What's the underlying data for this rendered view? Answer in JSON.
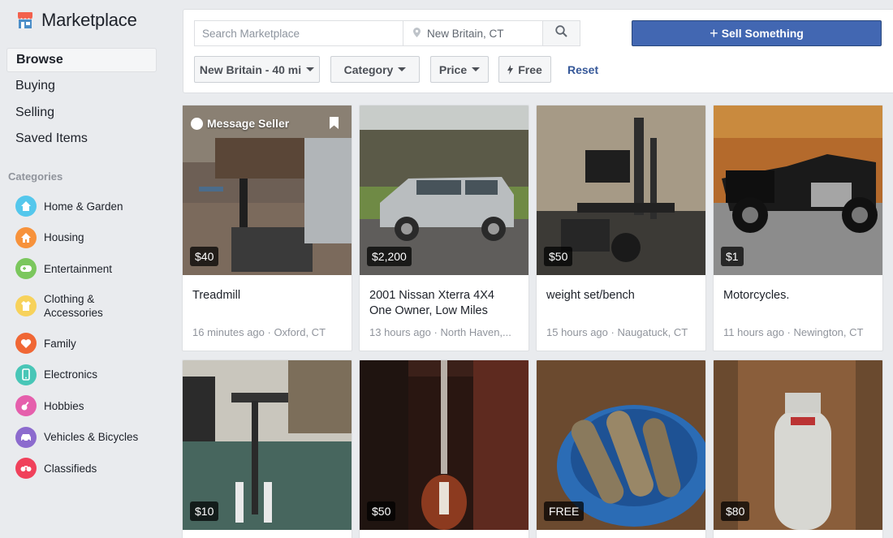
{
  "brand": {
    "title": "Marketplace",
    "icon": "shop-icon",
    "color": "#f3614d"
  },
  "nav": [
    "Browse",
    "Buying",
    "Selling",
    "Saved Items"
  ],
  "categories_heading": "Categories",
  "categories": [
    {
      "label": "Home & Garden",
      "icon": "home-icon",
      "color": "#54c7ec"
    },
    {
      "label": "Housing",
      "icon": "house-icon",
      "color": "#f7923b"
    },
    {
      "label": "Entertainment",
      "icon": "gamepad-icon",
      "color": "#7bc75d"
    },
    {
      "label": "Clothing & Accessories",
      "icon": "shirt-icon",
      "color": "#f7d25b"
    },
    {
      "label": "Family",
      "icon": "heart-icon",
      "color": "#f06735"
    },
    {
      "label": "Electronics",
      "icon": "phone-icon",
      "color": "#48c6b7"
    },
    {
      "label": "Hobbies",
      "icon": "guitar-icon",
      "color": "#e55fac"
    },
    {
      "label": "Vehicles & Bicycles",
      "icon": "car-icon",
      "color": "#8c6bce"
    },
    {
      "label": "Classifieds",
      "icon": "classifieds-icon",
      "color": "#f0415b"
    }
  ],
  "search": {
    "placeholder": "Search Marketplace",
    "location": "New Britain, CT"
  },
  "sell_button": "Sell Something",
  "filters": {
    "radius": "New Britain - 40 mi",
    "category": "Category",
    "price": "Price",
    "free": "Free",
    "reset": "Reset"
  },
  "listings": [
    {
      "price": "$40",
      "title": "Treadmill",
      "meta": "16 minutes ago · Oxford, CT",
      "hover": "Message Seller"
    },
    {
      "price": "$2,200",
      "title": "2001 Nissan Xterra 4X4 One Owner, Low Miles",
      "meta": "13 hours ago · North Haven,..."
    },
    {
      "price": "$50",
      "title": "weight set/bench",
      "meta": "15 hours ago · Naugatuck, CT"
    },
    {
      "price": "$1",
      "title": "Motorcycles.",
      "meta": "11 hours ago · Newington, CT"
    },
    {
      "price": "$10"
    },
    {
      "price": "$50"
    },
    {
      "price": "FREE"
    },
    {
      "price": "$80"
    }
  ]
}
